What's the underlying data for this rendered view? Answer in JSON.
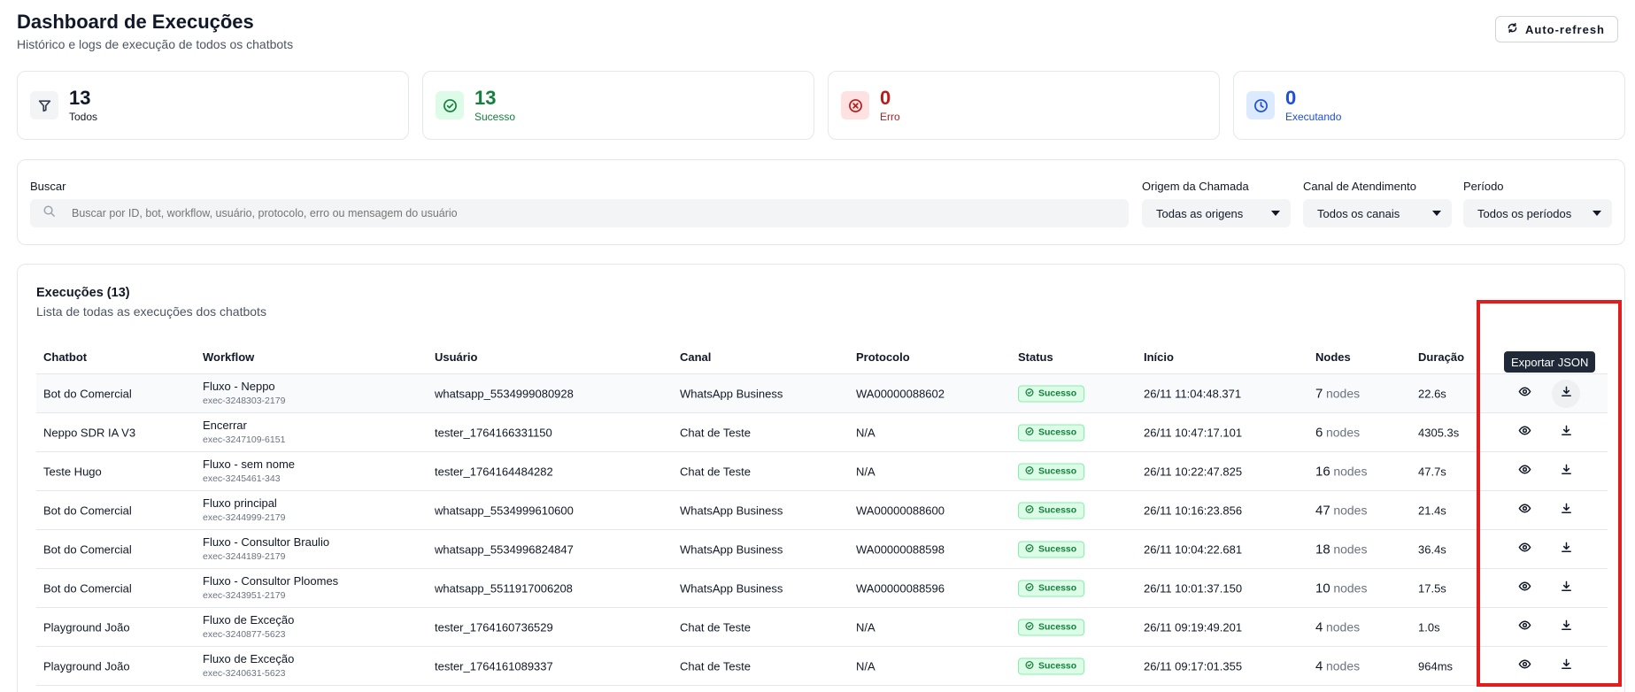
{
  "header": {
    "title": "Dashboard de Execuções",
    "subtitle": "Histórico e logs de execução de todos os chatbots",
    "refresh_label": "Auto-refresh"
  },
  "stats": [
    {
      "value": "13",
      "label": "Todos",
      "icon": "filter-icon",
      "color": "#111827",
      "bg": "#f3f4f6"
    },
    {
      "value": "13",
      "label": "Sucesso",
      "icon": "check-circle-icon",
      "color": "#15803d",
      "bg": "#dcfce7"
    },
    {
      "value": "0",
      "label": "Erro",
      "icon": "x-circle-icon",
      "color": "#b91c1c",
      "bg": "#fee2e2"
    },
    {
      "value": "0",
      "label": "Executando",
      "icon": "clock-icon",
      "color": "#1d4ed8",
      "bg": "#dbeafe"
    }
  ],
  "filters": {
    "search_label": "Buscar",
    "search_placeholder": "Buscar por ID, bot, workflow, usuário, protocolo, erro ou mensagem do usuário",
    "origin_label": "Origem da Chamada",
    "origin_value": "Todas as origens",
    "channel_label": "Canal de Atendimento",
    "channel_value": "Todos os canais",
    "period_label": "Período",
    "period_value": "Todos os períodos"
  },
  "table": {
    "title": "Execuções (13)",
    "subtitle": "Lista de todas as execuções dos chatbots",
    "columns": [
      "Chatbot",
      "Workflow",
      "Usuário",
      "Canal",
      "Protocolo",
      "Status",
      "Início",
      "Nodes",
      "Duração"
    ],
    "nodes_suffix": "nodes",
    "rows": [
      {
        "chatbot": "Bot do Comercial",
        "workflow": "Fluxo - Neppo",
        "exec_id": "exec-3248303-2179",
        "user": "whatsapp_5534999080928",
        "channel": "WhatsApp Business",
        "protocol": "WA00000088602",
        "status": "Sucesso",
        "start": "26/11 11:04:48.371",
        "nodes": "7",
        "duration": "22.6s"
      },
      {
        "chatbot": "Neppo SDR IA V3",
        "workflow": "Encerrar",
        "exec_id": "exec-3247109-6151",
        "user": "tester_1764166331150",
        "channel": "Chat de Teste",
        "protocol": "N/A",
        "status": "Sucesso",
        "start": "26/11 10:47:17.101",
        "nodes": "6",
        "duration": "4305.3s"
      },
      {
        "chatbot": "Teste Hugo",
        "workflow": "Fluxo - sem nome",
        "exec_id": "exec-3245461-343",
        "user": "tester_1764164484282",
        "channel": "Chat de Teste",
        "protocol": "N/A",
        "status": "Sucesso",
        "start": "26/11 10:22:47.825",
        "nodes": "16",
        "duration": "47.7s"
      },
      {
        "chatbot": "Bot do Comercial",
        "workflow": "Fluxo principal",
        "exec_id": "exec-3244999-2179",
        "user": "whatsapp_5534999610600",
        "channel": "WhatsApp Business",
        "protocol": "WA00000088600",
        "status": "Sucesso",
        "start": "26/11 10:16:23.856",
        "nodes": "47",
        "duration": "21.4s"
      },
      {
        "chatbot": "Bot do Comercial",
        "workflow": "Fluxo - Consultor Braulio",
        "exec_id": "exec-3244189-2179",
        "user": "whatsapp_5534996824847",
        "channel": "WhatsApp Business",
        "protocol": "WA00000088598",
        "status": "Sucesso",
        "start": "26/11 10:04:22.681",
        "nodes": "18",
        "duration": "36.4s"
      },
      {
        "chatbot": "Bot do Comercial",
        "workflow": "Fluxo - Consultor Ploomes",
        "exec_id": "exec-3243951-2179",
        "user": "whatsapp_5511917006208",
        "channel": "WhatsApp Business",
        "protocol": "WA00000088596",
        "status": "Sucesso",
        "start": "26/11 10:01:37.150",
        "nodes": "10",
        "duration": "17.5s"
      },
      {
        "chatbot": "Playground João",
        "workflow": "Fluxo de Exceção",
        "exec_id": "exec-3240877-5623",
        "user": "tester_1764160736529",
        "channel": "Chat de Teste",
        "protocol": "N/A",
        "status": "Sucesso",
        "start": "26/11 09:19:49.201",
        "nodes": "4",
        "duration": "1.0s"
      },
      {
        "chatbot": "Playground João",
        "workflow": "Fluxo de Exceção",
        "exec_id": "exec-3240631-5623",
        "user": "tester_1764161089337",
        "channel": "Chat de Teste",
        "protocol": "N/A",
        "status": "Sucesso",
        "start": "26/11 09:17:01.355",
        "nodes": "4",
        "duration": "964ms"
      }
    ]
  },
  "tooltip": "Exportar JSON",
  "colors": {
    "highlight": "#e11d1d",
    "success": "#15803d"
  }
}
